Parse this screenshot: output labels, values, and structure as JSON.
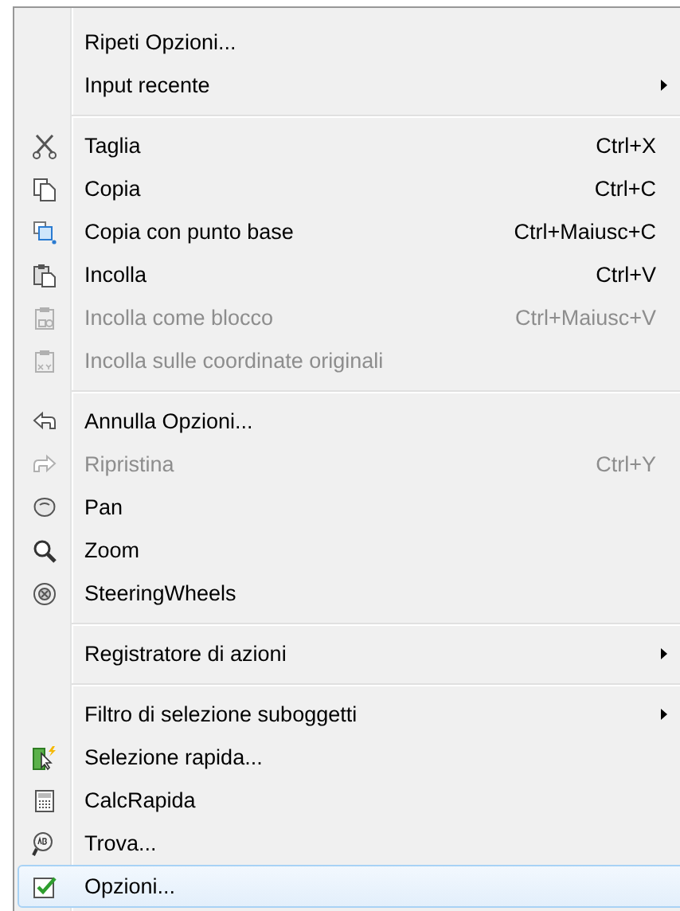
{
  "menu": {
    "sections": [
      {
        "items": [
          {
            "label": "Ripeti Opzioni...",
            "disabled": false,
            "selected": false,
            "submenu": false
          },
          {
            "label": "Input recente",
            "disabled": false,
            "selected": false,
            "submenu": true
          }
        ]
      },
      {
        "items": [
          {
            "label": "Taglia",
            "shortcut": "Ctrl+X",
            "disabled": false,
            "selected": false,
            "submenu": false
          },
          {
            "label": "Copia",
            "shortcut": "Ctrl+C",
            "disabled": false,
            "selected": false,
            "submenu": false
          },
          {
            "label": "Copia con punto base",
            "shortcut": "Ctrl+Maiusc+C",
            "disabled": false,
            "selected": false,
            "submenu": false
          },
          {
            "label": "Incolla",
            "shortcut": "Ctrl+V",
            "disabled": false,
            "selected": false,
            "submenu": false
          },
          {
            "label": "Incolla come blocco",
            "shortcut": "Ctrl+Maiusc+V",
            "disabled": true,
            "selected": false,
            "submenu": false
          },
          {
            "label": "Incolla sulle coordinate originali",
            "disabled": true,
            "selected": false,
            "submenu": false
          }
        ]
      },
      {
        "items": [
          {
            "label": "Annulla Opzioni...",
            "disabled": false,
            "selected": false,
            "submenu": false
          },
          {
            "label": "Ripristina",
            "shortcut": "Ctrl+Y",
            "disabled": true,
            "selected": false,
            "submenu": false
          },
          {
            "label": "Pan",
            "disabled": false,
            "selected": false,
            "submenu": false
          },
          {
            "label": "Zoom",
            "disabled": false,
            "selected": false,
            "submenu": false
          },
          {
            "label": "SteeringWheels",
            "disabled": false,
            "selected": false,
            "submenu": false
          }
        ]
      },
      {
        "items": [
          {
            "label": "Registratore di azioni",
            "disabled": false,
            "selected": false,
            "submenu": true
          }
        ]
      },
      {
        "items": [
          {
            "label": "Filtro di selezione suboggetti",
            "disabled": false,
            "selected": false,
            "submenu": true
          },
          {
            "label": "Selezione rapida...",
            "disabled": false,
            "selected": false,
            "submenu": false
          },
          {
            "label": "CalcRapida",
            "disabled": false,
            "selected": false,
            "submenu": false
          },
          {
            "label": "Trova...",
            "disabled": false,
            "selected": false,
            "submenu": false
          },
          {
            "label": "Opzioni...",
            "disabled": false,
            "selected": true,
            "submenu": false
          }
        ]
      }
    ]
  }
}
